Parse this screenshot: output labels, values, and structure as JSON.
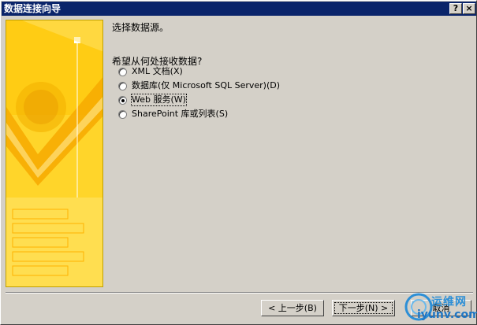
{
  "window": {
    "title": "数据连接向导",
    "help_label": "?",
    "close_label": "×"
  },
  "main": {
    "prompt": "选择数据源。",
    "question": "希望从何处接收数据?",
    "options": [
      {
        "label": "XML 文档(X)",
        "checked": false
      },
      {
        "label": "数据库(仅 Microsoft SQL Server)(D)",
        "checked": false
      },
      {
        "label": "Web 服务(W)",
        "checked": true
      },
      {
        "label": "SharePoint 库或列表(S)",
        "checked": false
      }
    ]
  },
  "footer": {
    "back_label": "< 上一步(B)",
    "next_label": "下一步(N) >",
    "cancel_label": "取消"
  },
  "watermark": {
    "name": "运维网",
    "url": "iyunv.com"
  },
  "colors": {
    "titlebar": "#0a246a",
    "art_yellow": "#ffd21a",
    "art_orange": "#f2a400",
    "face": "#d4d0c8"
  }
}
